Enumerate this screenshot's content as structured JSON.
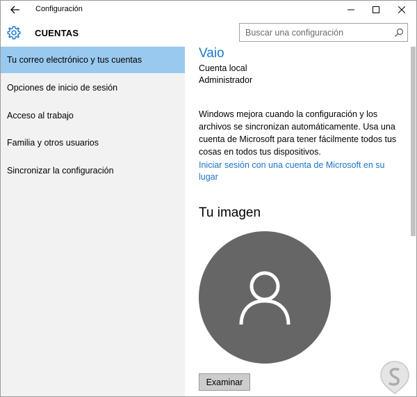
{
  "window": {
    "title": "Configuración",
    "back_icon": "back-arrow-icon",
    "controls": [
      "minimize-icon",
      "maximize-icon",
      "close-icon"
    ]
  },
  "header": {
    "icon": "gear-icon",
    "section_title": "CUENTAS",
    "search_placeholder": "Buscar una configuración",
    "search_icon": "search-icon"
  },
  "sidebar": {
    "items": [
      {
        "label": "Tu correo electrónico y tus cuentas",
        "active": true
      },
      {
        "label": "Opciones de inicio de sesión",
        "active": false
      },
      {
        "label": "Acceso al trabajo",
        "active": false
      },
      {
        "label": "Familia y otros usuarios",
        "active": false
      },
      {
        "label": "Sincronizar la configuración",
        "active": false
      }
    ]
  },
  "account": {
    "name": "Vaio",
    "type": "Cuenta local",
    "role": "Administrador",
    "sync_text": "Windows mejora cuando la configuración y los archivos se sincronizan automáticamente. Usa una cuenta de Microsoft para tener fácilmente todos tus cosas en todos tus dispositivos.",
    "link": "Iniciar sesión con una cuenta de Microsoft en su lugar"
  },
  "picture": {
    "heading": "Tu imagen",
    "avatar_icon": "user-silhouette-icon",
    "browse_label": "Examinar"
  },
  "colors": {
    "accent": "#1979ca",
    "active_nav": "#99c9ef",
    "sidebar_bg": "#f2f2f2",
    "avatar_bg": "#666666"
  }
}
